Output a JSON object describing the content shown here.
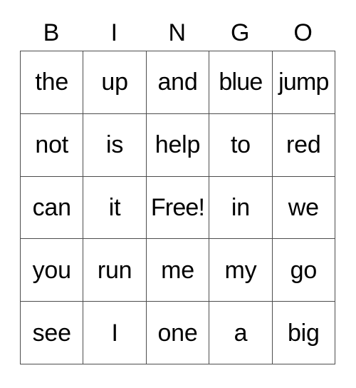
{
  "card": {
    "headers": [
      "B",
      "I",
      "N",
      "G",
      "O"
    ],
    "rows": [
      [
        "the",
        "up",
        "and",
        "blue",
        "jump"
      ],
      [
        "not",
        "is",
        "help",
        "to",
        "red"
      ],
      [
        "can",
        "it",
        "Free!",
        "in",
        "we"
      ],
      [
        "you",
        "run",
        "me",
        "my",
        "go"
      ],
      [
        "see",
        "I",
        "one",
        "a",
        "big"
      ]
    ],
    "free_space_label": "Free!",
    "colors": {
      "background": "#ffffff",
      "grid_line": "#4d4d4d",
      "text": "#000000"
    }
  }
}
